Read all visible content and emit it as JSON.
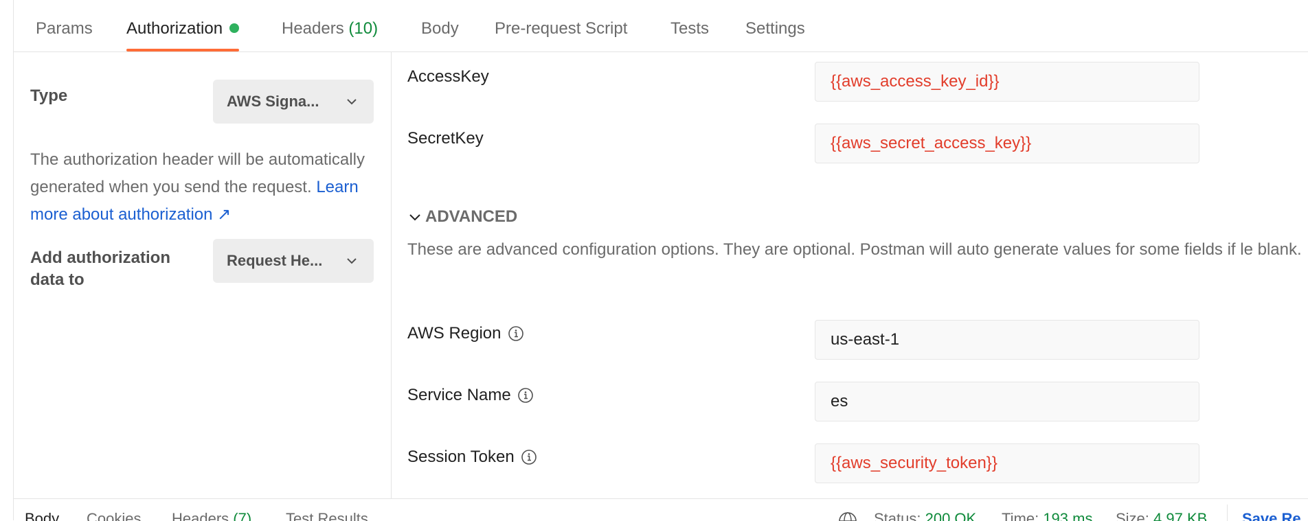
{
  "tabs": [
    {
      "label": "Params"
    },
    {
      "label": "Authorization"
    },
    {
      "label": "Headers",
      "count": "(10)"
    },
    {
      "label": "Body"
    },
    {
      "label": "Pre-request Script"
    },
    {
      "label": "Tests"
    },
    {
      "label": "Settings"
    }
  ],
  "auth": {
    "type_label": "Type",
    "type_value": "AWS Signa...",
    "description": "The authorization header will be automatically generated when you send the request.",
    "learn_more": "Learn more about authorization ↗",
    "add_to_label": "Add authorization data to",
    "add_to_value": "Request He..."
  },
  "fields": {
    "access_key": {
      "label": "AccessKey",
      "value": "{{aws_access_key_id}}"
    },
    "secret_key": {
      "label": "SecretKey",
      "value": "{{aws_secret_access_key}}"
    },
    "region": {
      "label": "AWS Region",
      "value": "us-east-1"
    },
    "service": {
      "label": "Service Name",
      "value": "es"
    },
    "session_token": {
      "label": "Session Token",
      "value": "{{aws_security_token}}"
    }
  },
  "advanced": {
    "title": "ADVANCED",
    "description": "These are advanced configuration options. They are optional. Postman will auto generate values for some fields if le blank."
  },
  "response": {
    "tabs": [
      {
        "label": "Body"
      },
      {
        "label": "Cookies"
      },
      {
        "label": "Headers",
        "count": "(7)"
      },
      {
        "label": "Test Results"
      }
    ],
    "status_label": "Status:",
    "status_value": "200 OK",
    "time_label": "Time:",
    "time_value": "193 ms",
    "size_label": "Size:",
    "size_value": "4.97 KB",
    "save_label": "Save Re"
  },
  "colors": {
    "accent": "#ff6c37",
    "variable": "#e23d2b",
    "link": "#1b5fd1",
    "success": "#0f8a3b"
  }
}
